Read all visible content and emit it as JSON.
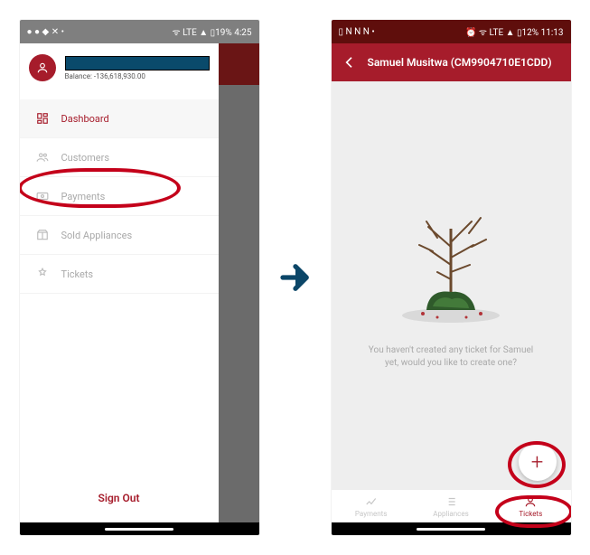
{
  "left": {
    "status": {
      "left": "● ● ◆ ✕ •",
      "right": "ᯤ LTE ▲ ▯19% 4:25"
    },
    "balance_label": "Balance: -136,618,930.00",
    "menu": {
      "dashboard": "Dashboard",
      "customers": "Customers",
      "payments": "Payments",
      "sold": "Sold Appliances",
      "tickets": "Tickets"
    },
    "signout": "Sign Out"
  },
  "right": {
    "status": {
      "left": "▯ N N N •",
      "right": "⏰ ᯤ LTE ▲ ▯12% 11:13"
    },
    "title": "Samuel Musitwa (CM9904710E1CDD)",
    "empty_state": "You haven't created any ticket for Samuel yet, would you like to create one?",
    "fab_label": "+",
    "tabs": {
      "payments": "Payments",
      "appliances": "Appliances",
      "tickets": "Tickets"
    }
  }
}
